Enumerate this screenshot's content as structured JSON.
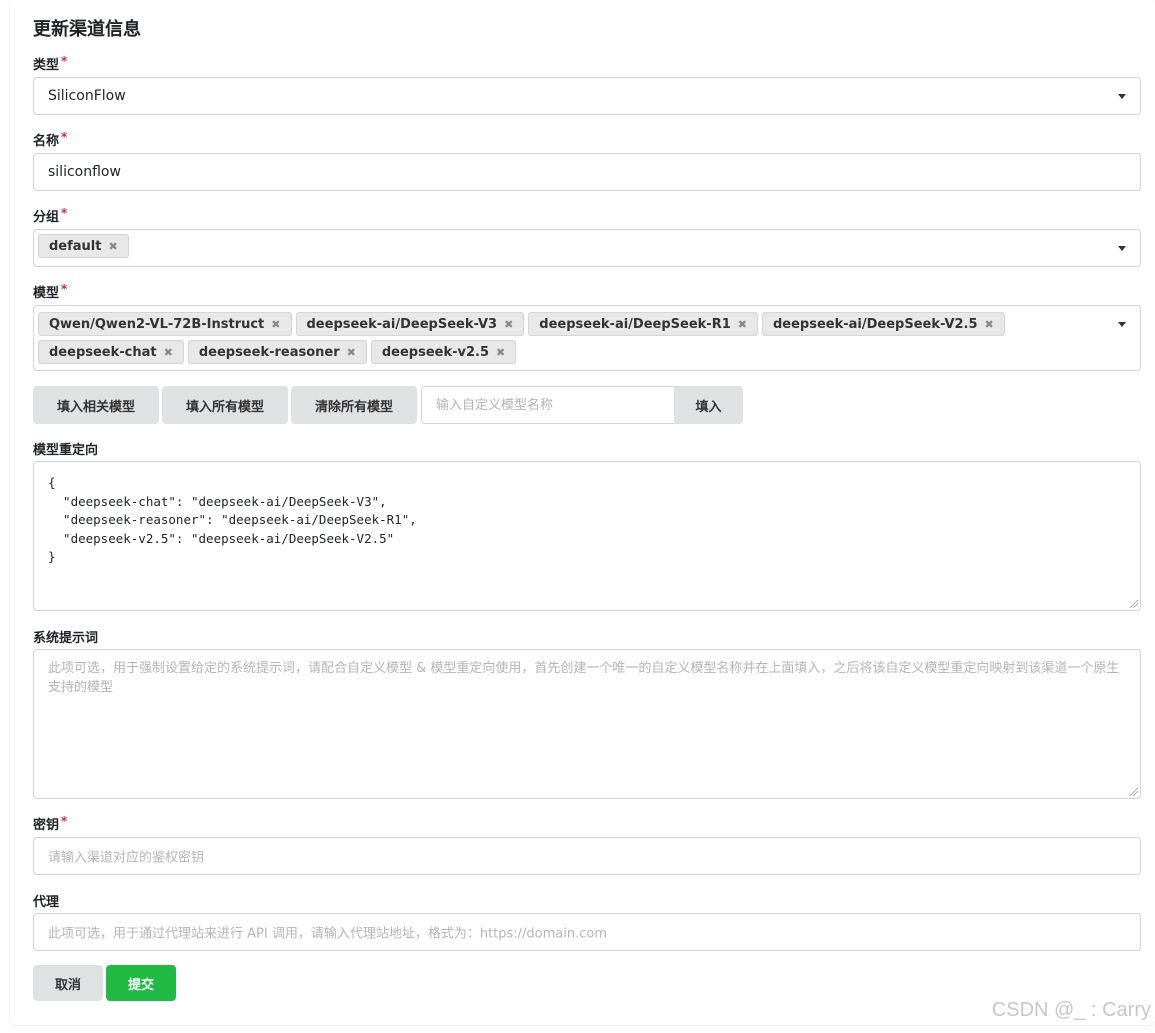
{
  "page_title": "更新渠道信息",
  "type_field": {
    "label": "类型",
    "required_mark": "*",
    "value": "SiliconFlow"
  },
  "name_field": {
    "label": "名称",
    "required_mark": "*",
    "value": "siliconflow"
  },
  "group_field": {
    "label": "分组",
    "required_mark": "*",
    "tags": [
      {
        "label": "default",
        "remove": "✖"
      }
    ]
  },
  "model_field": {
    "label": "模型",
    "required_mark": "*",
    "tags": [
      {
        "label": "Qwen/Qwen2-VL-72B-Instruct",
        "remove": "✖"
      },
      {
        "label": "deepseek-ai/DeepSeek-V3",
        "remove": "✖"
      },
      {
        "label": "deepseek-ai/DeepSeek-R1",
        "remove": "✖"
      },
      {
        "label": "deepseek-ai/DeepSeek-V2.5",
        "remove": "✖"
      },
      {
        "label": "deepseek-chat",
        "remove": "✖"
      },
      {
        "label": "deepseek-reasoner",
        "remove": "✖"
      },
      {
        "label": "deepseek-v2.5",
        "remove": "✖"
      }
    ]
  },
  "model_actions": {
    "fill_related": "填入相关模型",
    "fill_all": "填入所有模型",
    "clear_all": "清除所有模型",
    "custom_placeholder": "输入自定义模型名称",
    "fill_custom": "填入"
  },
  "model_mapping": {
    "label": "模型重定向",
    "value": "{\n  \"deepseek-chat\": \"deepseek-ai/DeepSeek-V3\",\n  \"deepseek-reasoner\": \"deepseek-ai/DeepSeek-R1\",\n  \"deepseek-v2.5\": \"deepseek-ai/DeepSeek-V2.5\"\n}"
  },
  "system_prompt": {
    "label": "系统提示词",
    "placeholder": "此项可选，用于强制设置给定的系统提示词，请配合自定义模型 & 模型重定向使用，首先创建一个唯一的自定义模型名称并在上面填入，之后将该自定义模型重定向映射到该渠道一个原生支持的模型"
  },
  "key_field": {
    "label": "密钥",
    "required_mark": "*",
    "placeholder": "请输入渠道对应的鉴权密钥"
  },
  "proxy_field": {
    "label": "代理",
    "placeholder": "此项可选，用于通过代理站来进行 API 调用，请输入代理站地址，格式为：https://domain.com"
  },
  "footer": {
    "cancel": "取消",
    "submit": "提交"
  },
  "watermark": "CSDN @_ : Carry",
  "colors": {
    "primary_green": "#21ba45",
    "required_red": "#db2828",
    "button_gray": "#e0e1e2"
  }
}
